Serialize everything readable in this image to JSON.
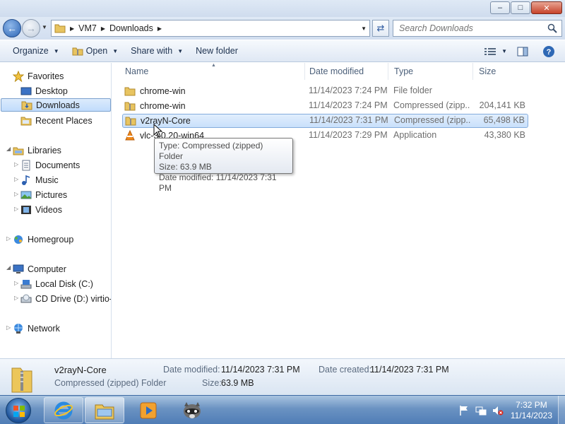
{
  "window": {
    "minimize": "–",
    "maximize": "□",
    "close": "✕"
  },
  "address": {
    "crumbs": [
      "VM7",
      "Downloads"
    ],
    "search_placeholder": "Search Downloads"
  },
  "toolbar": {
    "organize": "Organize",
    "open": "Open",
    "share_with": "Share with",
    "new_folder": "New folder"
  },
  "nav": {
    "favorites": "Favorites",
    "desktop": "Desktop",
    "downloads": "Downloads",
    "recent_places": "Recent Places",
    "libraries": "Libraries",
    "documents": "Documents",
    "music": "Music",
    "pictures": "Pictures",
    "videos": "Videos",
    "homegroup": "Homegroup",
    "computer": "Computer",
    "local_disk": "Local Disk (C:)",
    "cd_drive": "CD Drive (D:) virtio-w",
    "network": "Network"
  },
  "columns": {
    "name": "Name",
    "date_modified": "Date modified",
    "type": "Type",
    "size": "Size"
  },
  "files": [
    {
      "name": "chrome-win",
      "date": "11/14/2023 7:24 PM",
      "type": "File folder",
      "size": "",
      "icon": "folder-icon"
    },
    {
      "name": "chrome-win",
      "date": "11/14/2023 7:24 PM",
      "type": "Compressed (zipp...",
      "size": "204,141 KB",
      "icon": "zip-folder-icon"
    },
    {
      "name": "v2rayN-Core",
      "date": "11/14/2023 7:31 PM",
      "type": "Compressed (zipp...",
      "size": "65,498 KB",
      "icon": "zip-folder-icon"
    },
    {
      "name": "vlc-3.0.20-win64",
      "date": "11/14/2023 7:29 PM",
      "type": "Application",
      "size": "43,380 KB",
      "icon": "vlc-icon"
    }
  ],
  "tooltip": {
    "type": "Type: Compressed (zipped) Folder",
    "size": "Size: 63.9 MB",
    "date": "Date modified: 11/14/2023 7:31 PM"
  },
  "details": {
    "name": "v2rayN-Core",
    "kind": "Compressed (zipped) Folder",
    "date_modified_label": "Date modified:",
    "date_modified": "11/14/2023 7:31 PM",
    "date_created_label": "Date created:",
    "date_created": "11/14/2023 7:31 PM",
    "size_label": "Size:",
    "size": "63.9 MB"
  },
  "taskbar": {
    "time": "7:32 PM",
    "date": "11/14/2023"
  },
  "colors": {
    "selection": "#c9e0fb",
    "accent": "#2c64b4"
  }
}
